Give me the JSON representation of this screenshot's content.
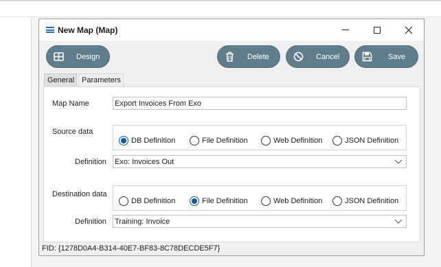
{
  "window": {
    "title": "New Map (Map)",
    "icon": "menu-lines-icon"
  },
  "toolbar": {
    "design_label": "Design",
    "delete_label": "Delete",
    "cancel_label": "Cancel",
    "save_label": "Save"
  },
  "tabs": [
    {
      "label": "General",
      "active": true
    },
    {
      "label": "Parameters",
      "active": false
    }
  ],
  "form": {
    "map_name_label": "Map Name",
    "map_name_value": "Export Invoices From Exo",
    "source": {
      "label": "Source data",
      "options": [
        "DB Definition",
        "File Definition",
        "Web Definition",
        "JSON Definition"
      ],
      "selected": "DB Definition",
      "definition_label": "Definition",
      "definition_value": "Exo: Invoices Out"
    },
    "destination": {
      "label": "Destination data",
      "options": [
        "DB Definition",
        "File Definition",
        "Web Definition",
        "JSON Definition"
      ],
      "selected": "File Definition",
      "definition_label": "Definition",
      "definition_value": "Training: Invoice"
    }
  },
  "footer": {
    "fid": "FID: {1278D0A4-B314-40E7-BF83-8C78DECDE5F7}"
  },
  "colors": {
    "button_bg": "#607d8b",
    "radio_selected": "#0a57b0",
    "title_icon": "#2a6fb8"
  }
}
